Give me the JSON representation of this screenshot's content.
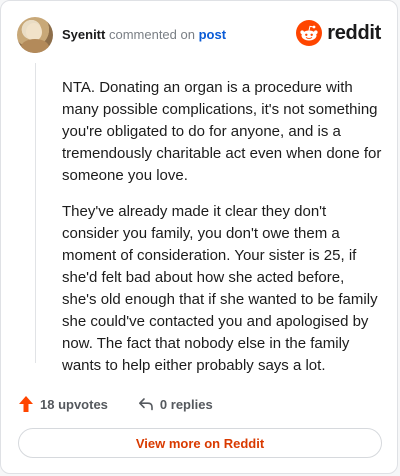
{
  "header": {
    "username": "Syenitt",
    "action_text": "commented on",
    "post_link": "post",
    "brand": "reddit"
  },
  "comment": {
    "paragraphs": [
      "NTA. Donating an organ is a procedure with many possible complications, it's not something you're obligated to do for anyone, and is a tremendously charitable act even when done for someone you love.",
      "They've already made it clear they don't consider you family, you don't owe them a moment of consideration. Your sister is 25, if she'd felt bad about how she acted before, she's old enough that if she wanted to be family she could've contacted you and apologised by now. The fact that nobody else in the family wants to help either probably says a lot."
    ]
  },
  "actions": {
    "upvotes_label": "18 upvotes",
    "replies_label": "0 replies"
  },
  "footer": {
    "view_more_label": "View more on Reddit"
  },
  "colors": {
    "brand_orange": "#ff4500",
    "link_blue": "#0a5bd6",
    "view_more_text": "#d93a00"
  },
  "icons": {
    "upvote": "arrow-up-icon",
    "reply": "reply-icon",
    "logo": "reddit-snoo-icon"
  }
}
